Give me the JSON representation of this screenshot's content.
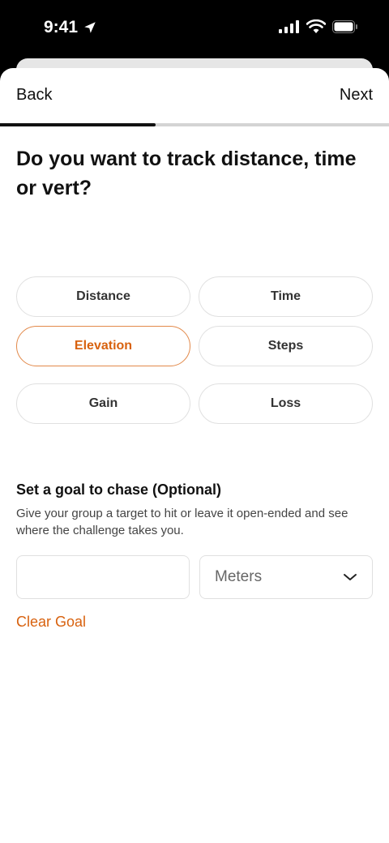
{
  "status_bar": {
    "time": "9:41",
    "icons": [
      "location-arrow-icon",
      "cellular-signal-icon",
      "wifi-icon",
      "battery-icon"
    ]
  },
  "nav": {
    "back_label": "Back",
    "next_label": "Next",
    "progress": 0.4
  },
  "title": "Do you want to track distance, time or vert?",
  "metric_options": [
    {
      "label": "Distance",
      "selected": false
    },
    {
      "label": "Time",
      "selected": false
    },
    {
      "label": "Elevation",
      "selected": true
    },
    {
      "label": "Steps",
      "selected": false
    },
    {
      "label": "Gain",
      "selected": false
    },
    {
      "label": "Loss",
      "selected": false
    }
  ],
  "goal": {
    "title": "Set a goal to chase (Optional)",
    "description": "Give your group a target to hit or leave it open-ended and see where the challenge takes you.",
    "value": "",
    "unit": "Meters",
    "unit_icon": "chevron-down-icon",
    "clear_label": "Clear Goal"
  },
  "colors": {
    "accent": "#d8620f",
    "selected_border": "#e2894a"
  }
}
